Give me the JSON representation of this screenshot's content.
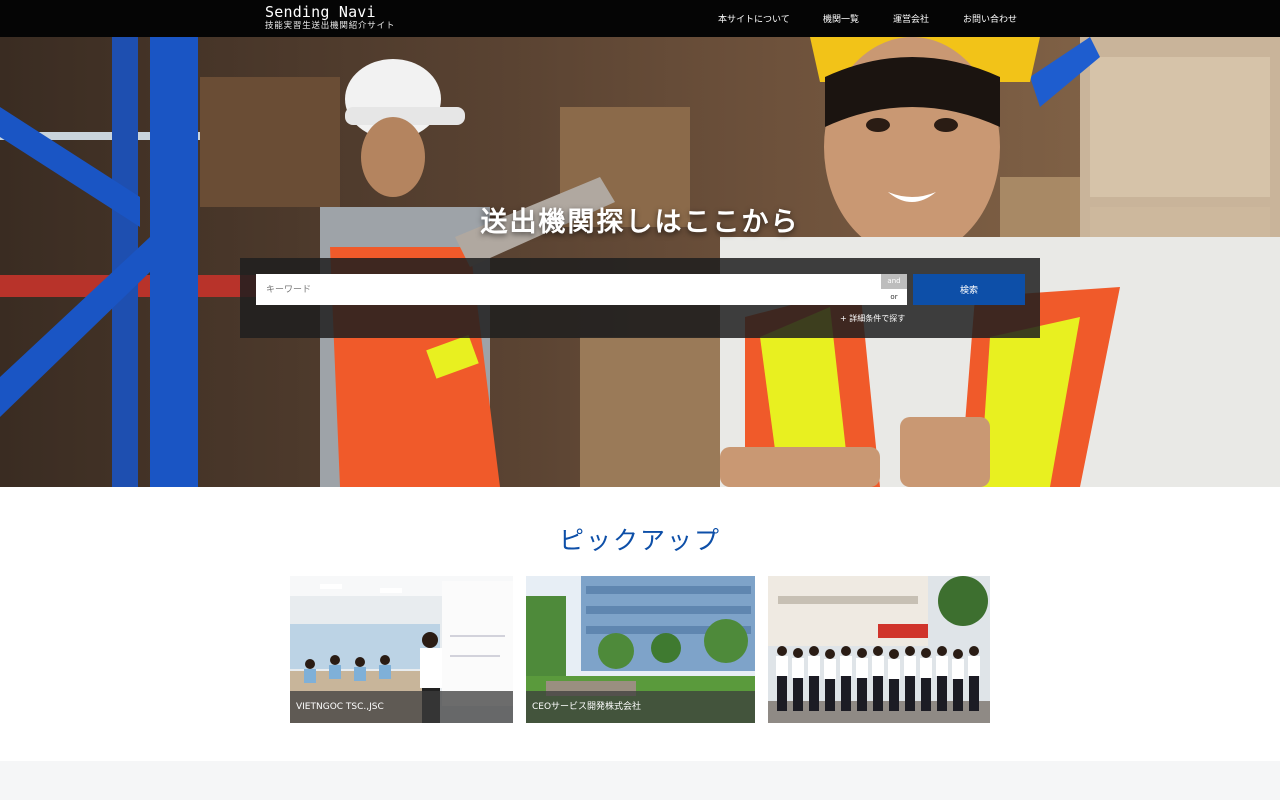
{
  "site": {
    "name": "Sending Navi",
    "tagline": "技能実習生送出機関紹介サイト"
  },
  "nav": [
    "本サイトについて",
    "機関一覧",
    "運営会社",
    "お問い合わせ"
  ],
  "hero": {
    "title": "送出機関探しはここから",
    "search": {
      "placeholder": "キーワード",
      "and_label": "and",
      "or_label": "or",
      "button_label": "検索",
      "advanced_label": "+ 詳細条件で探す"
    }
  },
  "pickup": {
    "title": "ピックアップ",
    "cards": [
      {
        "caption": "VIETNGOC TSC.,JSC"
      },
      {
        "caption": "CEOサービス開発株式会社"
      },
      {
        "caption": ""
      }
    ]
  }
}
